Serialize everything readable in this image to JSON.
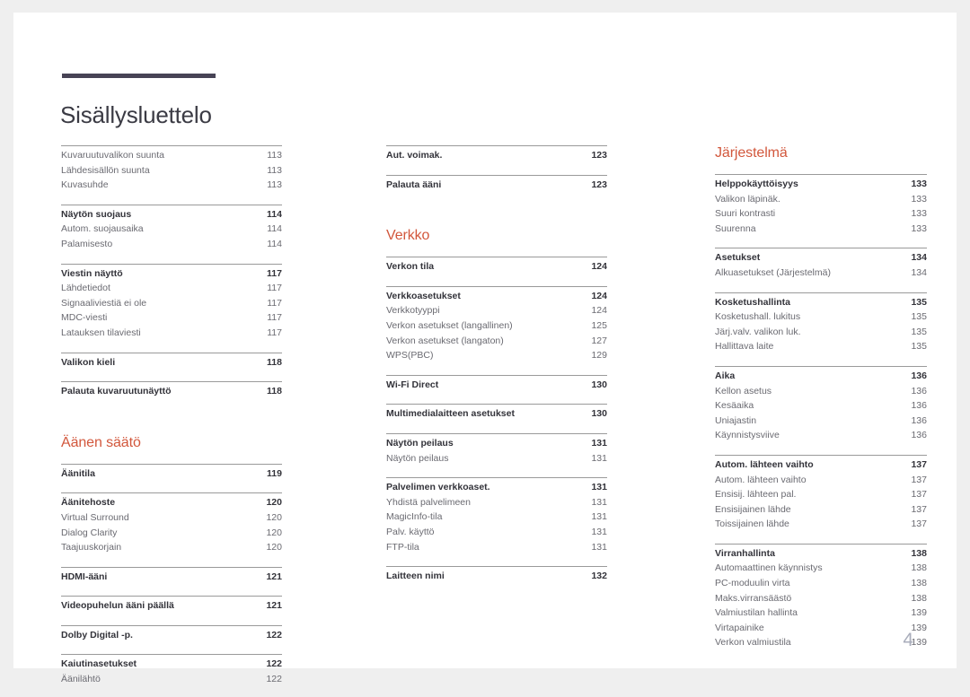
{
  "document": {
    "title": "Sisällysluettelo",
    "page_number": "4",
    "accent_color": "#d2573c",
    "rule_color": "#474355",
    "folio_color": "#a9adbb"
  },
  "columns": [
    {
      "id": "column-1",
      "blocks": [
        {
          "type": "group",
          "space_before": "none",
          "entries": [
            {
              "label": "Kuvaruutuvalikon suunta",
              "page": "113",
              "level": 2
            },
            {
              "label": "Lähdesisällön suunta",
              "page": "113",
              "level": 2
            },
            {
              "label": "Kuvasuhde",
              "page": "113",
              "level": 2
            }
          ]
        },
        {
          "type": "group",
          "space_before": "sm",
          "entries": [
            {
              "label": "Näytön suojaus",
              "page": "114",
              "level": 1
            },
            {
              "label": "Autom. suojausaika",
              "page": "114",
              "level": 2
            },
            {
              "label": "Palamisesto",
              "page": "114",
              "level": 2
            }
          ]
        },
        {
          "type": "group",
          "space_before": "sm",
          "entries": [
            {
              "label": "Viestin näyttö",
              "page": "117",
              "level": 1
            },
            {
              "label": "Lähdetiedot",
              "page": "117",
              "level": 2
            },
            {
              "label": "Signaaliviestiä ei ole",
              "page": "117",
              "level": 2
            },
            {
              "label": "MDC-viesti",
              "page": "117",
              "level": 2
            },
            {
              "label": "Latauksen tilaviesti",
              "page": "117",
              "level": 2
            }
          ]
        },
        {
          "type": "group",
          "space_before": "sm",
          "entries": [
            {
              "label": "Valikon kieli",
              "page": "118",
              "level": 1
            }
          ]
        },
        {
          "type": "group",
          "space_before": "sm",
          "entries": [
            {
              "label": "Palauta kuvaruutunäyttö",
              "page": "118",
              "level": 1
            }
          ]
        },
        {
          "type": "heading",
          "space_before": "lg",
          "label": "Äänen säätö"
        },
        {
          "type": "group",
          "space_before": "heading",
          "entries": [
            {
              "label": "Äänitila",
              "page": "119",
              "level": 1
            }
          ]
        },
        {
          "type": "group",
          "space_before": "sm",
          "entries": [
            {
              "label": "Äänitehoste",
              "page": "120",
              "level": 1
            },
            {
              "label": "Virtual Surround",
              "page": "120",
              "level": 2
            },
            {
              "label": "Dialog Clarity",
              "page": "120",
              "level": 2
            },
            {
              "label": "Taajuuskorjain",
              "page": "120",
              "level": 2
            }
          ]
        },
        {
          "type": "group",
          "space_before": "sm",
          "entries": [
            {
              "label": "HDMI-ääni",
              "page": "121",
              "level": 1
            }
          ]
        },
        {
          "type": "group",
          "space_before": "sm",
          "entries": [
            {
              "label": "Videopuhelun ääni päällä",
              "page": "121",
              "level": 1
            }
          ]
        },
        {
          "type": "group",
          "space_before": "sm",
          "entries": [
            {
              "label": "Dolby Digital -p.",
              "page": "122",
              "level": 1
            }
          ]
        },
        {
          "type": "group",
          "space_before": "sm",
          "entries": [
            {
              "label": "Kaiutinasetukset",
              "page": "122",
              "level": 1
            },
            {
              "label": "Äänilähtö",
              "page": "122",
              "level": 2
            }
          ]
        }
      ]
    },
    {
      "id": "column-2",
      "blocks": [
        {
          "type": "group",
          "space_before": "none",
          "entries": [
            {
              "label": "Aut. voimak.",
              "page": "123",
              "level": 1
            }
          ]
        },
        {
          "type": "group",
          "space_before": "sm",
          "entries": [
            {
              "label": "Palauta ääni",
              "page": "123",
              "level": 1
            }
          ]
        },
        {
          "type": "heading",
          "space_before": "lg",
          "label": "Verkko"
        },
        {
          "type": "group",
          "space_before": "heading",
          "entries": [
            {
              "label": "Verkon tila",
              "page": "124",
              "level": 1
            }
          ]
        },
        {
          "type": "group",
          "space_before": "sm",
          "entries": [
            {
              "label": "Verkkoasetukset",
              "page": "124",
              "level": 1
            },
            {
              "label": "Verkkotyyppi",
              "page": "124",
              "level": 2
            },
            {
              "label": "Verkon asetukset (langallinen)",
              "page": "125",
              "level": 2
            },
            {
              "label": "Verkon asetukset (langaton)",
              "page": "127",
              "level": 2
            },
            {
              "label": "WPS(PBC)",
              "page": "129",
              "level": 2
            }
          ]
        },
        {
          "type": "group",
          "space_before": "sm",
          "entries": [
            {
              "label": "Wi-Fi Direct",
              "page": "130",
              "level": 1
            }
          ]
        },
        {
          "type": "group",
          "space_before": "sm",
          "entries": [
            {
              "label": "Multimedialaitteen asetukset",
              "page": "130",
              "level": 1
            }
          ]
        },
        {
          "type": "group",
          "space_before": "sm",
          "entries": [
            {
              "label": "Näytön peilaus",
              "page": "131",
              "level": 1
            },
            {
              "label": "Näytön peilaus",
              "page": "131",
              "level": 2
            }
          ]
        },
        {
          "type": "group",
          "space_before": "sm",
          "entries": [
            {
              "label": "Palvelimen verkkoaset.",
              "page": "131",
              "level": 1
            },
            {
              "label": "Yhdistä palvelimeen",
              "page": "131",
              "level": 2
            },
            {
              "label": "MagicInfo-tila",
              "page": "131",
              "level": 2
            },
            {
              "label": "Palv. käyttö",
              "page": "131",
              "level": 2
            },
            {
              "label": "FTP-tila",
              "page": "131",
              "level": 2
            }
          ]
        },
        {
          "type": "group",
          "space_before": "sm",
          "entries": [
            {
              "label": "Laitteen nimi",
              "page": "132",
              "level": 1
            }
          ]
        }
      ]
    },
    {
      "id": "column-3",
      "blocks": [
        {
          "type": "heading",
          "space_before": "none",
          "label": "Järjestelmä"
        },
        {
          "type": "group",
          "space_before": "heading",
          "entries": [
            {
              "label": "Helppokäyttöisyys",
              "page": "133",
              "level": 1
            },
            {
              "label": "Valikon läpinäk.",
              "page": "133",
              "level": 2
            },
            {
              "label": "Suuri kontrasti",
              "page": "133",
              "level": 2
            },
            {
              "label": "Suurenna",
              "page": "133",
              "level": 2
            }
          ]
        },
        {
          "type": "group",
          "space_before": "sm",
          "entries": [
            {
              "label": "Asetukset",
              "page": "134",
              "level": 1
            },
            {
              "label": "Alkuasetukset (Järjestelmä)",
              "page": "134",
              "level": 2
            }
          ]
        },
        {
          "type": "group",
          "space_before": "sm",
          "entries": [
            {
              "label": "Kosketushallinta",
              "page": "135",
              "level": 1
            },
            {
              "label": "Kosketushall. lukitus",
              "page": "135",
              "level": 2
            },
            {
              "label": "Järj.valv. valikon luk.",
              "page": "135",
              "level": 2
            },
            {
              "label": "Hallittava laite",
              "page": "135",
              "level": 2
            }
          ]
        },
        {
          "type": "group",
          "space_before": "sm",
          "entries": [
            {
              "label": "Aika",
              "page": "136",
              "level": 1
            },
            {
              "label": "Kellon asetus",
              "page": "136",
              "level": 2
            },
            {
              "label": "Kesäaika",
              "page": "136",
              "level": 2
            },
            {
              "label": "Uniajastin",
              "page": "136",
              "level": 2
            },
            {
              "label": "Käynnistysviive",
              "page": "136",
              "level": 2
            }
          ]
        },
        {
          "type": "group",
          "space_before": "sm",
          "entries": [
            {
              "label": "Autom. lähteen vaihto",
              "page": "137",
              "level": 1
            },
            {
              "label": "Autom. lähteen vaihto",
              "page": "137",
              "level": 2
            },
            {
              "label": "Ensisij. lähteen pal.",
              "page": "137",
              "level": 2
            },
            {
              "label": "Ensisijainen lähde",
              "page": "137",
              "level": 2
            },
            {
              "label": "Toissijainen lähde",
              "page": "137",
              "level": 2
            }
          ]
        },
        {
          "type": "group",
          "space_before": "sm",
          "entries": [
            {
              "label": "Virranhallinta",
              "page": "138",
              "level": 1
            },
            {
              "label": "Automaattinen käynnistys",
              "page": "138",
              "level": 2
            },
            {
              "label": "PC-moduulin virta",
              "page": "138",
              "level": 2
            },
            {
              "label": "Maks.virransäästö",
              "page": "138",
              "level": 2
            },
            {
              "label": "Valmiustilan hallinta",
              "page": "139",
              "level": 2
            },
            {
              "label": "Virtapainike",
              "page": "139",
              "level": 2
            },
            {
              "label": "Verkon valmiustila",
              "page": "139",
              "level": 2
            }
          ]
        }
      ]
    }
  ]
}
